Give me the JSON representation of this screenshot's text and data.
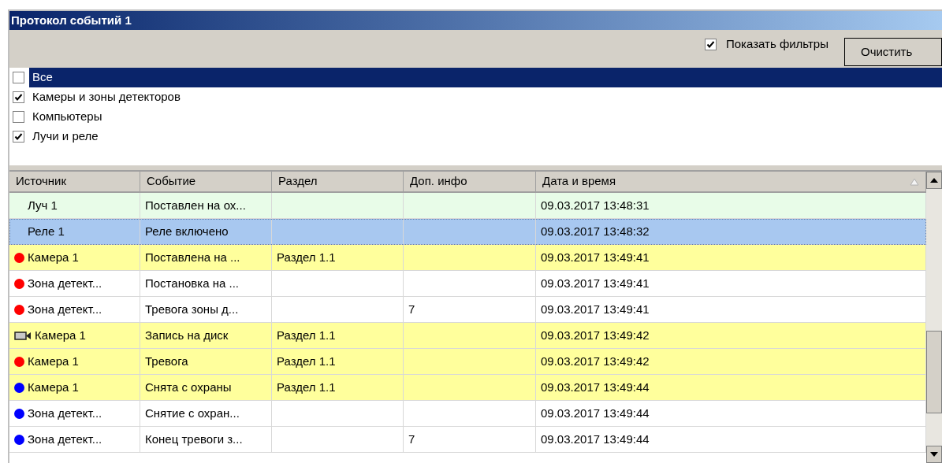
{
  "window": {
    "title": "Протокол событий 1"
  },
  "toolbar": {
    "show_filters": {
      "label": "Показать фильтры",
      "checked": true
    },
    "clear_button": "Очистить"
  },
  "filters": [
    {
      "label": "Все",
      "checked": false,
      "selected": true
    },
    {
      "label": "Камеры и зоны детекторов",
      "checked": true,
      "selected": false
    },
    {
      "label": "Компьютеры",
      "checked": false,
      "selected": false
    },
    {
      "label": "Лучи и реле",
      "checked": true,
      "selected": false
    }
  ],
  "table": {
    "columns": [
      "Источник",
      "Событие",
      "Раздел",
      "Доп. инфо",
      "Дата и время"
    ],
    "rows": [
      {
        "icon": {
          "kind": "none"
        },
        "color": "#e8fce8",
        "selected": false,
        "cells": [
          "Луч 1",
          "Поставлен на ох...",
          "",
          "",
          "09.03.2017 13:48:31"
        ]
      },
      {
        "icon": {
          "kind": "none"
        },
        "color": "#a8c8f0",
        "selected": true,
        "cells": [
          "Реле 1",
          "Реле включено",
          "",
          "",
          "09.03.2017 13:48:32"
        ]
      },
      {
        "icon": {
          "kind": "dot",
          "color": "#ff0000"
        },
        "color": "#ffff9c",
        "selected": false,
        "cells": [
          "Камера 1",
          "Поставлена на ...",
          "Раздел 1.1",
          "",
          "09.03.2017 13:49:41"
        ]
      },
      {
        "icon": {
          "kind": "dot",
          "color": "#ff0000"
        },
        "color": "#ffffff",
        "selected": false,
        "cells": [
          "Зона детект...",
          "Постановка на ...",
          "",
          "",
          "09.03.2017 13:49:41"
        ]
      },
      {
        "icon": {
          "kind": "dot",
          "color": "#ff0000"
        },
        "color": "#ffffff",
        "selected": false,
        "cells": [
          "Зона детект...",
          "Тревога зоны д...",
          "",
          "7",
          "09.03.2017 13:49:41"
        ]
      },
      {
        "icon": {
          "kind": "camera"
        },
        "color": "#ffff9c",
        "selected": false,
        "cells": [
          "Камера 1",
          "Запись на диск",
          "Раздел 1.1",
          "",
          "09.03.2017 13:49:42"
        ]
      },
      {
        "icon": {
          "kind": "dot",
          "color": "#ff0000"
        },
        "color": "#ffff9c",
        "selected": false,
        "cells": [
          "Камера 1",
          "Тревога",
          "Раздел 1.1",
          "",
          "09.03.2017 13:49:42"
        ]
      },
      {
        "icon": {
          "kind": "dot",
          "color": "#0000ff"
        },
        "color": "#ffff9c",
        "selected": false,
        "cells": [
          "Камера 1",
          "Снята с охраны",
          "Раздел 1.1",
          "",
          "09.03.2017 13:49:44"
        ]
      },
      {
        "icon": {
          "kind": "dot",
          "color": "#0000ff"
        },
        "color": "#ffffff",
        "selected": false,
        "cells": [
          "Зона детект...",
          "Снятие с охран...",
          "",
          "",
          "09.03.2017 13:49:44"
        ]
      },
      {
        "icon": {
          "kind": "dot",
          "color": "#0000ff"
        },
        "color": "#ffffff",
        "selected": false,
        "cells": [
          "Зона детект...",
          "Конец тревоги з...",
          "",
          "7",
          "09.03.2017 13:49:44"
        ]
      }
    ]
  }
}
